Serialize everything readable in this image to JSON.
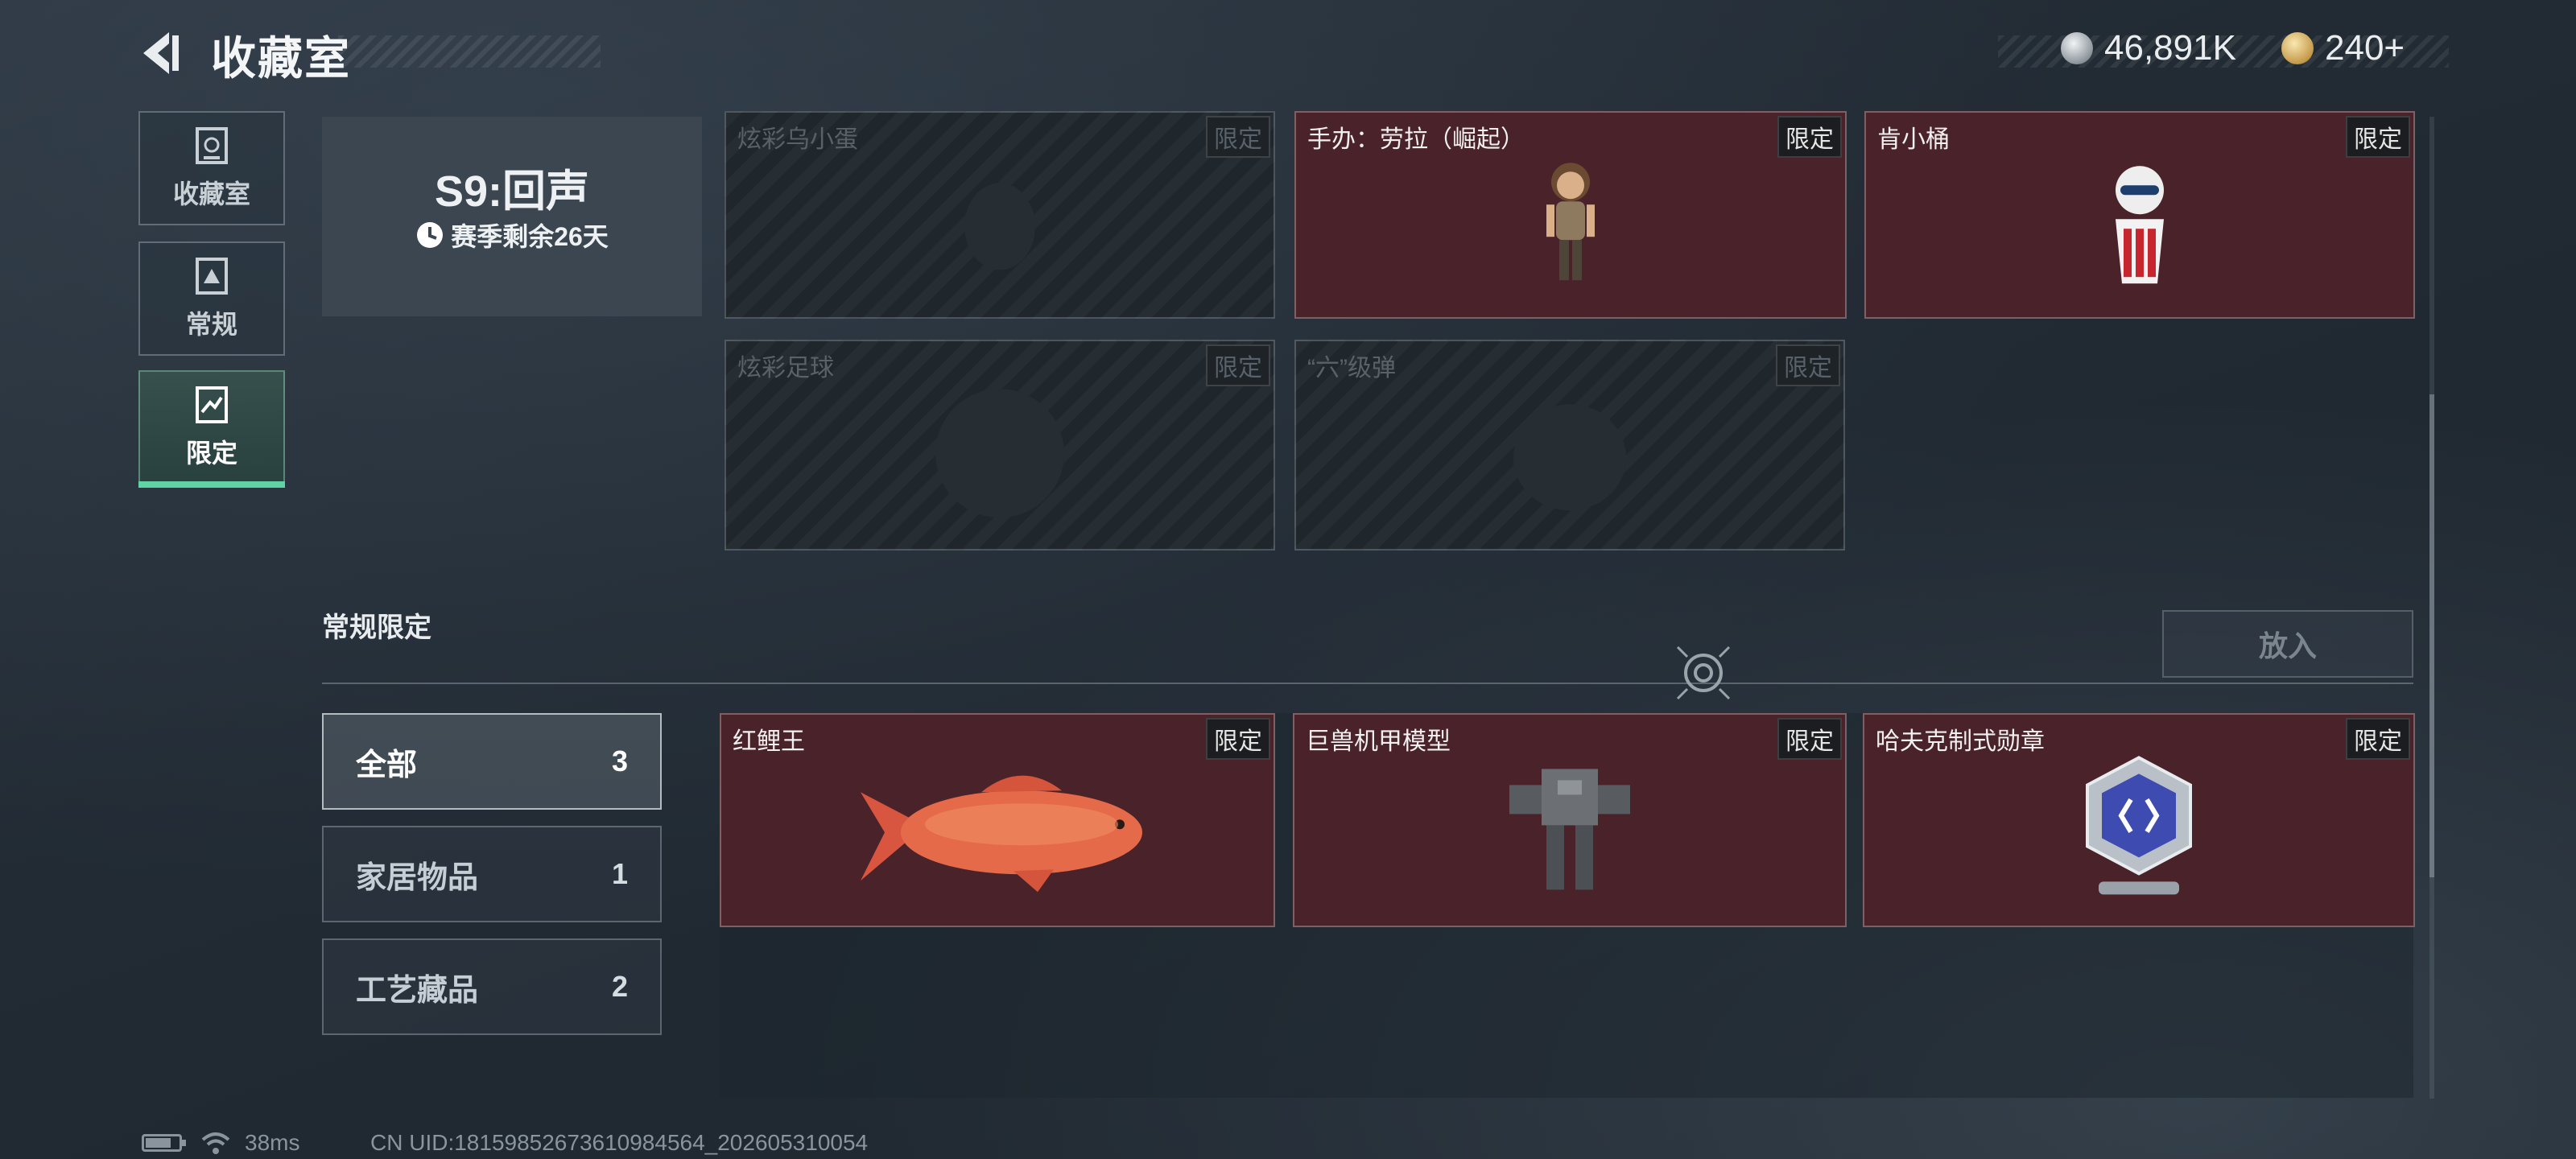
{
  "header": {
    "title": "收藏室"
  },
  "currency": [
    {
      "icon": "silver-coin-icon",
      "value": "46,891K"
    },
    {
      "icon": "gold-coin-icon",
      "value": "240+"
    }
  ],
  "nav": [
    {
      "label": "收藏室",
      "icon": "collection-room-icon"
    },
    {
      "label": "常规",
      "icon": "regular-icon"
    },
    {
      "label": "限定",
      "icon": "limited-icon",
      "active": true
    }
  ],
  "season": {
    "title": "S9:回声",
    "remaining": "赛季剩余26天"
  },
  "top_cards": [
    {
      "name": "炫彩乌小蛋",
      "tag": "限定",
      "owned": false
    },
    {
      "name": "手办：劳拉（崛起）",
      "tag": "限定",
      "owned": true
    },
    {
      "name": "肯小桶",
      "tag": "限定",
      "owned": true
    },
    {
      "name": "炫彩足球",
      "tag": "限定",
      "owned": false
    },
    {
      "name": "“六”级弹",
      "tag": "限定",
      "owned": false
    }
  ],
  "section": {
    "title": "常规限定",
    "put_button": "放入"
  },
  "filters": [
    {
      "label": "全部",
      "count": "3",
      "selected": true
    },
    {
      "label": "家居物品",
      "count": "1"
    },
    {
      "label": "工艺藏品",
      "count": "2"
    }
  ],
  "bottom_cards": [
    {
      "name": "红鲤王",
      "tag": "限定"
    },
    {
      "name": "巨兽机甲模型",
      "tag": "限定"
    },
    {
      "name": "哈夫克制式勋章",
      "tag": "限定"
    }
  ],
  "status": {
    "ping": "38ms",
    "uid": "CN UID:1815985267361098456​4_202605310054",
    "battery_level": 0.7
  }
}
